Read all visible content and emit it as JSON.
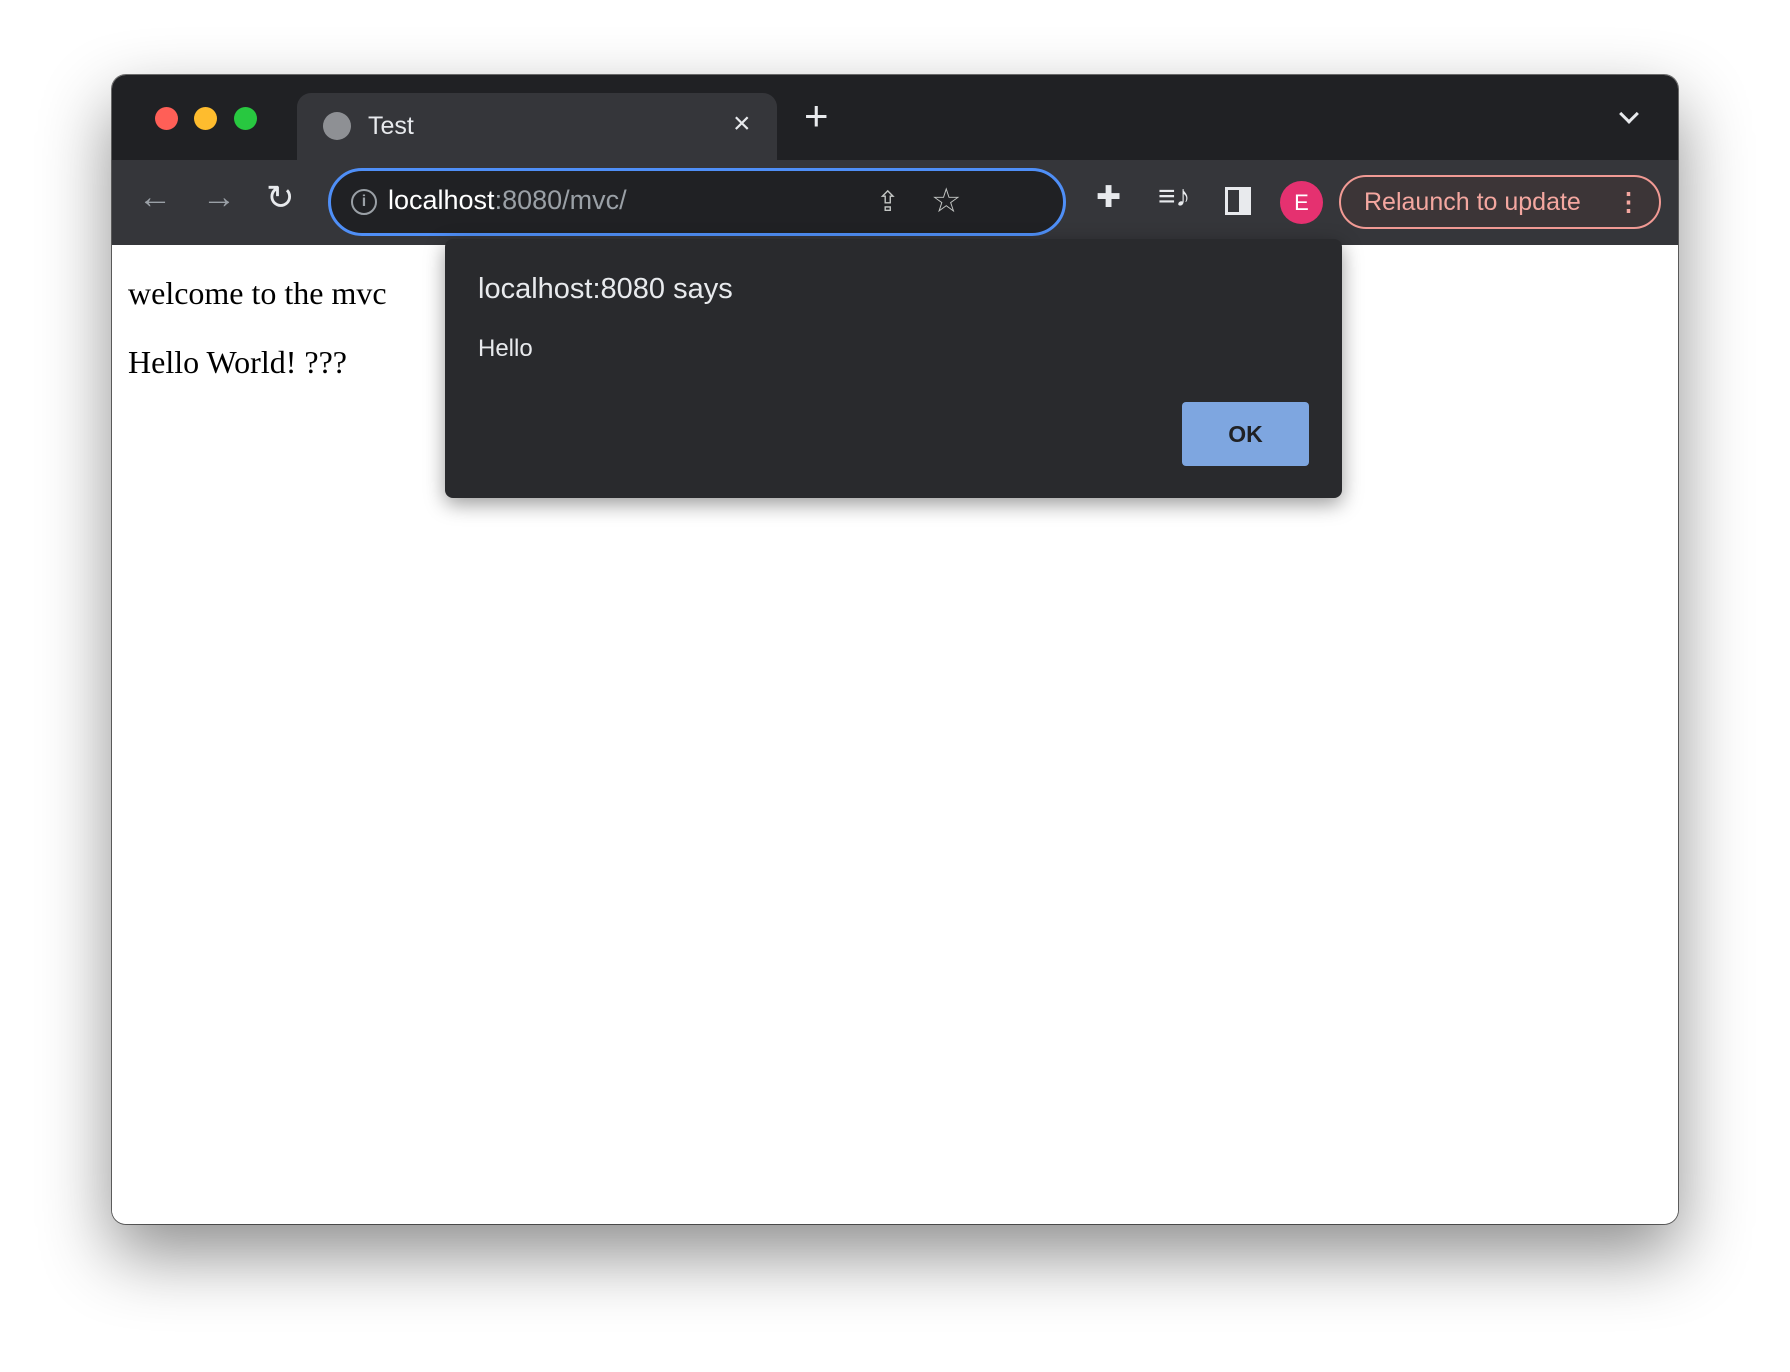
{
  "browser": {
    "tab": {
      "title": "Test",
      "close_icon": "×"
    },
    "new_tab_icon": "+",
    "address_bar": {
      "host": "localhost",
      "rest": ":8080/mvc/"
    },
    "profile_initial": "E",
    "relaunch_label": "Relaunch to update",
    "colors": {
      "accent": "#4f8ff7",
      "avatar": "#e53170",
      "relaunch": "#f4a7a0"
    }
  },
  "page": {
    "line1": "welcome to the mvc",
    "line2": "Hello World! ???"
  },
  "dialog": {
    "title": "localhost:8080 says",
    "message": "Hello",
    "ok_label": "OK"
  }
}
